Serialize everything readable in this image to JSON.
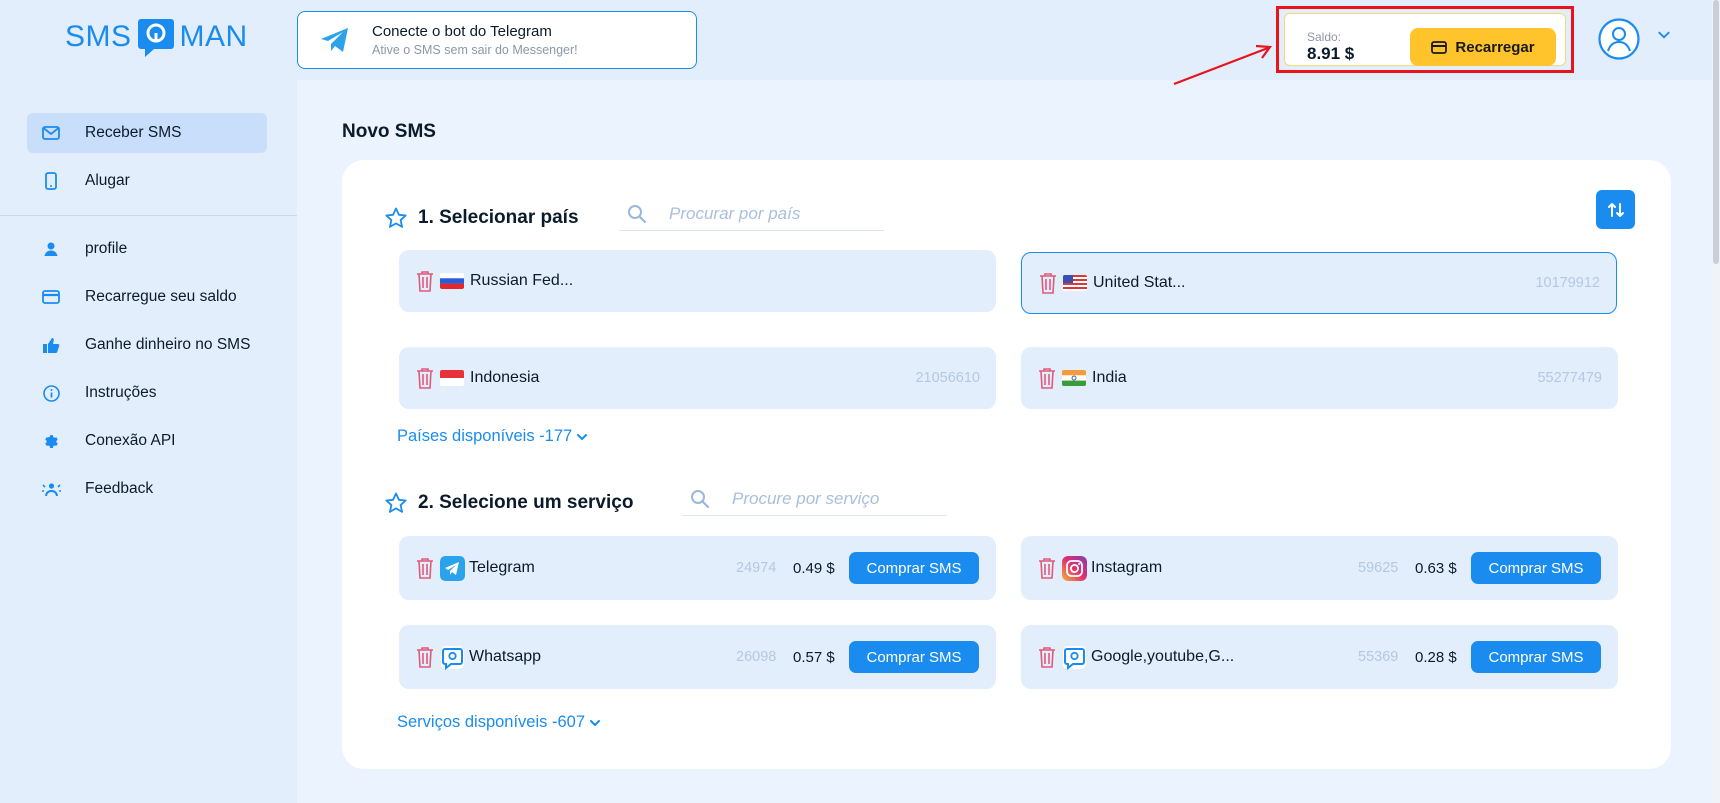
{
  "header": {
    "logo_left": "SMS",
    "logo_right": "MAN",
    "telegram_banner": {
      "title": "Conecte o bot do Telegram",
      "subtitle": "Ative o SMS sem sair do Messenger!"
    },
    "balance": {
      "label": "Saldo:",
      "value": "8.91 $",
      "recharge_label": "Recarregar"
    }
  },
  "sidebar": {
    "items": [
      {
        "label": "Receber SMS",
        "icon": "envelope-icon",
        "active": true
      },
      {
        "label": "Alugar",
        "icon": "phone-icon",
        "active": false
      },
      {
        "label": "profile",
        "icon": "user-icon",
        "active": false
      },
      {
        "label": "Recarregue seu saldo",
        "icon": "card-icon",
        "active": false
      },
      {
        "label": "Ganhe dinheiro no SMS",
        "icon": "thumbs-up-icon",
        "active": false
      },
      {
        "label": "Instruções",
        "icon": "info-icon",
        "active": false
      },
      {
        "label": "Conexão API",
        "icon": "gear-icon",
        "active": false
      },
      {
        "label": "Feedback",
        "icon": "feedback-icon",
        "active": false
      }
    ]
  },
  "main": {
    "title": "Novo SMS",
    "countries": {
      "heading": "1. Selecionar país",
      "search_placeholder": "Procurar por país",
      "items": [
        {
          "name": "Russian Fed...",
          "count": "",
          "flag": "ru"
        },
        {
          "name": "United Stat...",
          "count": "10179912",
          "flag": "us",
          "selected": true
        },
        {
          "name": "Indonesia",
          "count": "21056610",
          "flag": "id"
        },
        {
          "name": "India",
          "count": "55277479",
          "flag": "in"
        }
      ],
      "more_label": "Países disponíveis -177"
    },
    "services": {
      "heading": "2. Selecione um serviço",
      "search_placeholder": "Procure por serviço",
      "buy_label": "Comprar SMS",
      "items": [
        {
          "name": "Telegram",
          "count": "24974",
          "price": "0.49 $",
          "icon": "telegram-icon"
        },
        {
          "name": "Instagram",
          "count": "59625",
          "price": "0.63 $",
          "icon": "instagram-icon"
        },
        {
          "name": "Whatsapp",
          "count": "26098",
          "price": "0.57 $",
          "icon": "smsman-icon"
        },
        {
          "name": "Google,youtube,G...",
          "count": "55369",
          "price": "0.28 $",
          "icon": "smsman-icon"
        }
      ],
      "more_label": "Serviços disponíveis -607"
    }
  },
  "colors": {
    "accent": "#1a8cf0",
    "recharge": "#ffc42b",
    "highlight_box": "#e8141b",
    "trash": "#e05a7a"
  }
}
